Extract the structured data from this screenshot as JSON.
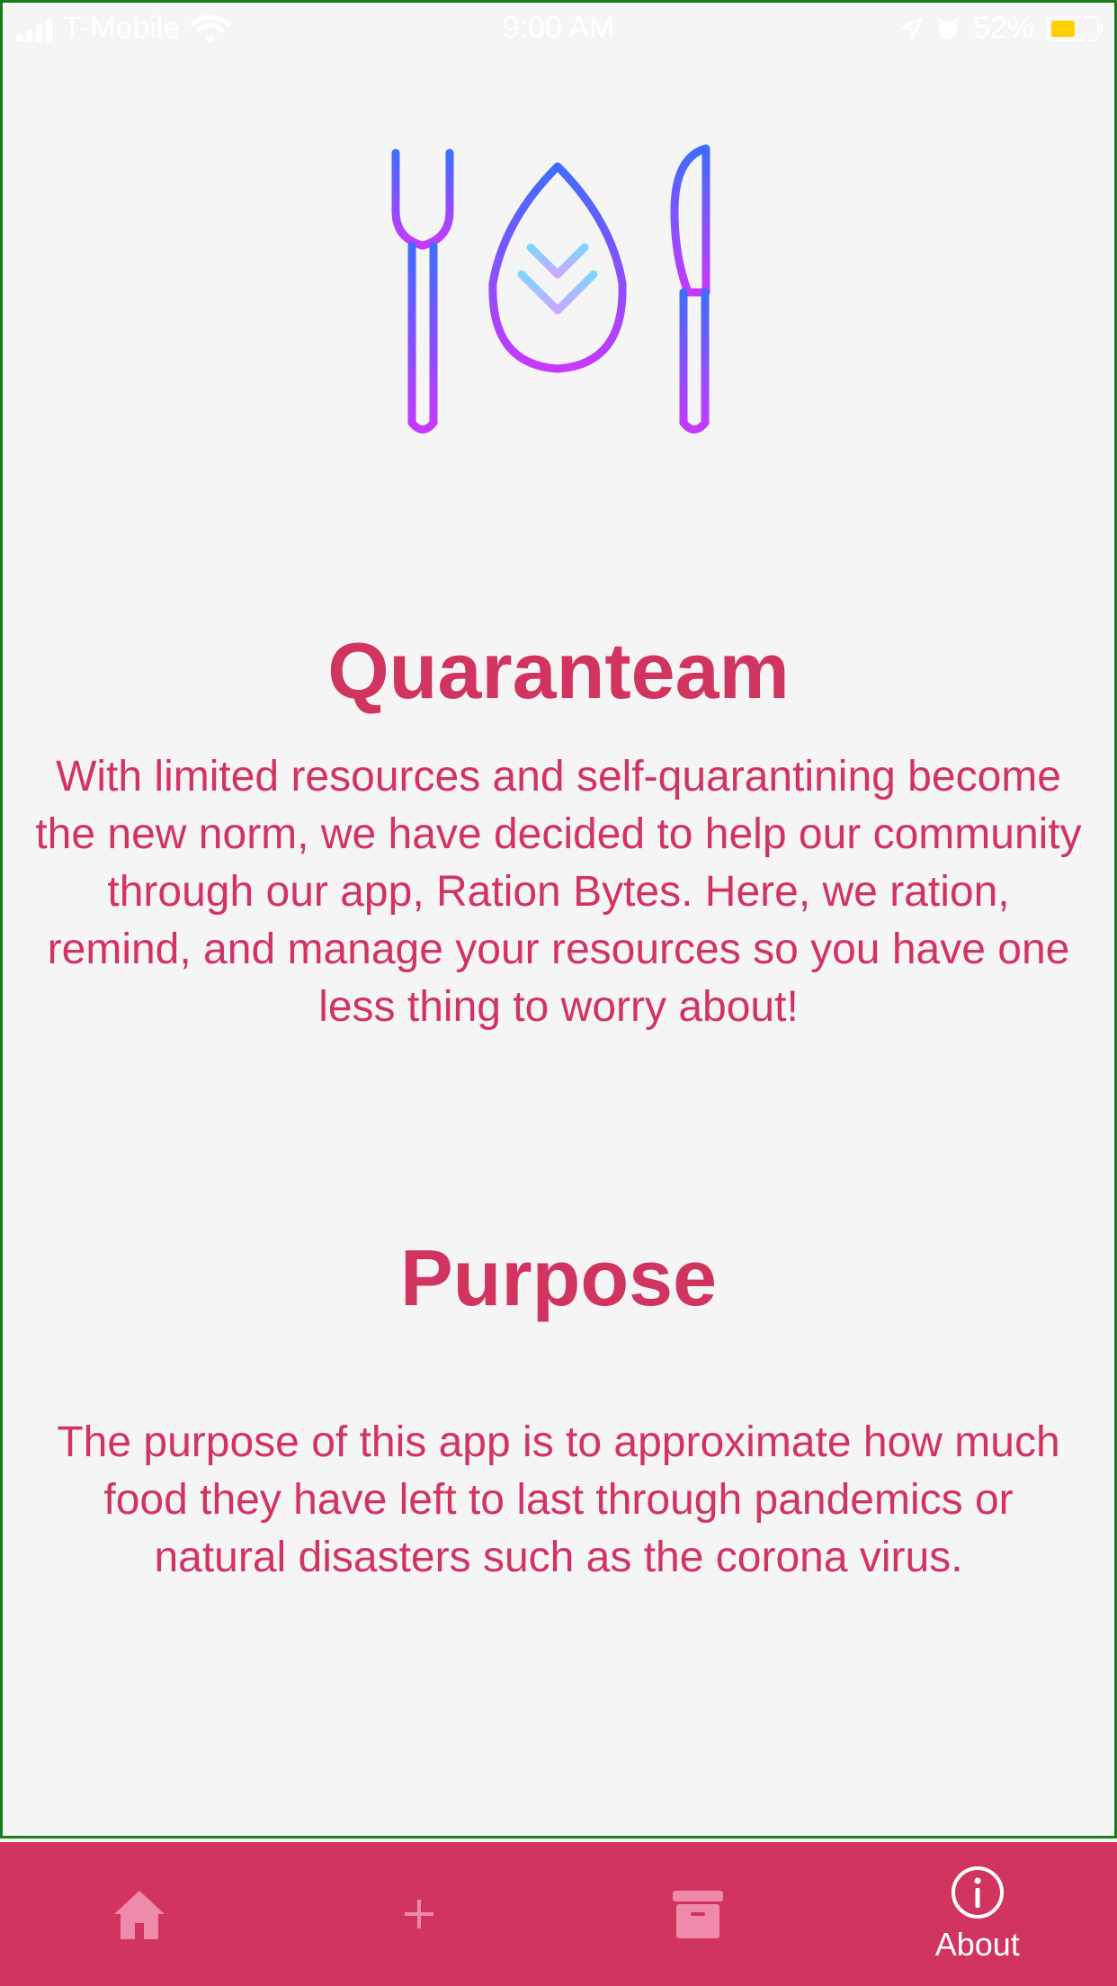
{
  "status_bar": {
    "carrier": "T-Mobile",
    "time": "9:00 AM",
    "battery": "52%"
  },
  "content": {
    "title": "Quaranteam",
    "intro": "With limited resources and self-quarantining become the new norm, we have decided to help our community through our app, Ration Bytes. Here, we ration, remind, and manage your resources so you have one less thing to worry about!",
    "purpose_heading": "Purpose",
    "purpose_text": "The purpose of this app is to approximate how much food they have left to last through pandemics or natural disasters such as the corona virus."
  },
  "tab_bar": {
    "tabs": [
      {
        "icon": "home-icon",
        "label": "",
        "active": false
      },
      {
        "icon": "plus-icon",
        "label": "",
        "active": false
      },
      {
        "icon": "archive-icon",
        "label": "",
        "active": false
      },
      {
        "icon": "info-icon",
        "label": "About",
        "active": true
      }
    ]
  },
  "colors": {
    "accent": "#d1345f",
    "background": "#f6f5f6",
    "inactive_tab_icon": "#f08aaa",
    "active_tab_icon": "#ffffff"
  }
}
